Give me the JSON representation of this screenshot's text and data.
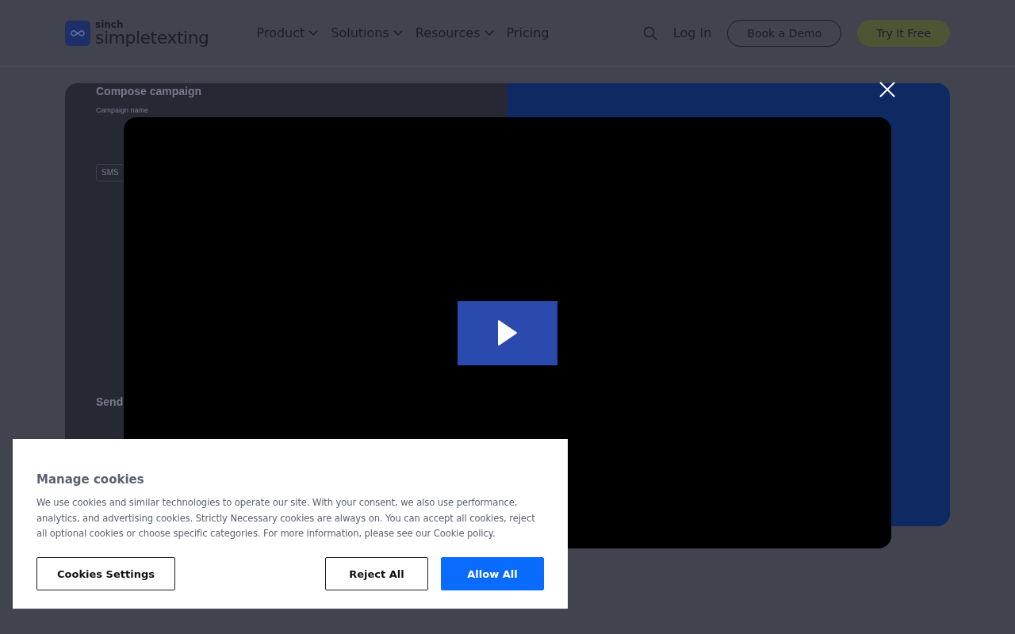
{
  "header": {
    "logo": {
      "brand": "sinch",
      "name": "simpletexting"
    },
    "nav": [
      {
        "label": "Product",
        "dropdown": true
      },
      {
        "label": "Solutions",
        "dropdown": true
      },
      {
        "label": "Resources",
        "dropdown": true
      },
      {
        "label": "Pricing",
        "dropdown": false
      }
    ],
    "login": "Log In",
    "demo_button": "Book a Demo",
    "trial_button": "Try It Free"
  },
  "hero": {
    "app_preview": {
      "title": "Compose campaign",
      "field_label": "Campaign name",
      "message_type": "SMS",
      "section": "Send"
    }
  },
  "video_modal": {
    "open": true
  },
  "cookie_banner": {
    "title": "Manage cookies",
    "text": "We use cookies and similar technologies to operate our site. With your consent, we also use performance, analytics, and advertising cookies. Strictly Necessary cookies are always on. You can accept all cookies, reject all optional cookies or choose specific categories. For more information, please see our Cookie policy.",
    "buttons": [
      {
        "label": "Cookies Settings",
        "kind": "outline"
      },
      {
        "label": "Reject All",
        "kind": "outline"
      },
      {
        "label": "Allow All",
        "kind": "primary"
      }
    ]
  }
}
